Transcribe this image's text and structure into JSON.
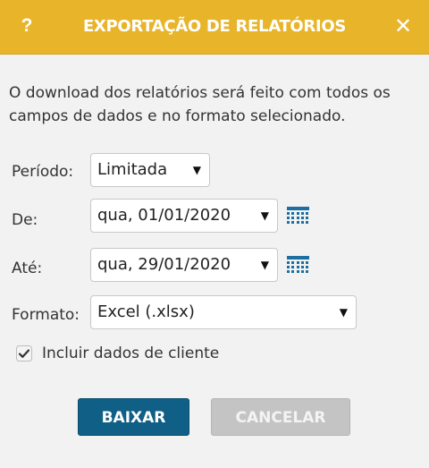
{
  "dialog": {
    "title": "EXPORTAÇÃO DE RELATÓRIOS",
    "help_symbol": "?",
    "close_symbol": "✕",
    "description": "O download dos relatórios será feito com todos os campos de dados e no formato selecionado."
  },
  "form": {
    "period": {
      "label": "Período:",
      "value": "Limitada"
    },
    "from": {
      "label": "De:",
      "value": "qua, 01/01/2020"
    },
    "to": {
      "label": "Até:",
      "value": "qua, 29/01/2020"
    },
    "format": {
      "label": "Formato:",
      "value": "Excel (.xlsx)"
    },
    "include_client": {
      "label": "Incluir dados de cliente",
      "checked": true
    }
  },
  "buttons": {
    "download": "BAIXAR",
    "cancel": "CANCELAR"
  },
  "colors": {
    "header": "#e8b42a",
    "primary": "#0f5f86",
    "disabled": "#c4c4c4",
    "calendar_icon": "#1d6fa0"
  },
  "icons": {
    "help": "question-mark",
    "close": "close-x",
    "dropdown": "triangle-down",
    "calendar": "calendar-grid"
  }
}
